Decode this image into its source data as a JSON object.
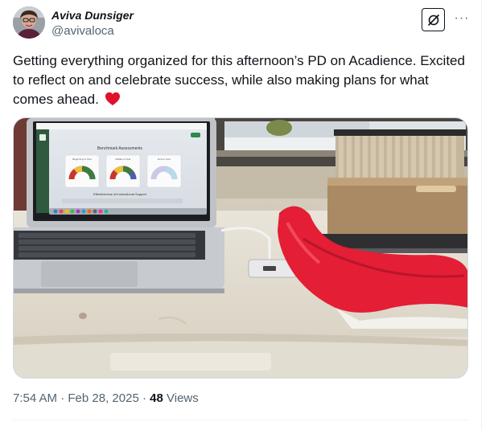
{
  "author": {
    "name": "Aviva Dunsiger",
    "handle": "@avivaloca"
  },
  "tweet": {
    "text": "Getting everything organized for this afternoon’s PD on Acadience. Excited to reflect on and celebrate success, while also making plans for what comes ahead.",
    "emoji": "red-heart-icon"
  },
  "actions": {
    "grok_icon": "grok-icon",
    "more_icon": "more-options-icon",
    "more_glyph": "···"
  },
  "media": {
    "laptop_screen": {
      "heading": "Benchmark Assessments",
      "cards": [
        "Beginning of Year",
        "Middle of Year",
        "End of Year"
      ],
      "footer": "Effectiveness of Instructional Support"
    }
  },
  "meta": {
    "time": "7:54 AM",
    "separator": "·",
    "date": "Feb 28, 2025",
    "views_count": "48",
    "views_label": "Views"
  },
  "colors": {
    "text": "#0f1419",
    "secondary": "#536471",
    "border": "#cfd9de",
    "heart": "#f91880"
  }
}
